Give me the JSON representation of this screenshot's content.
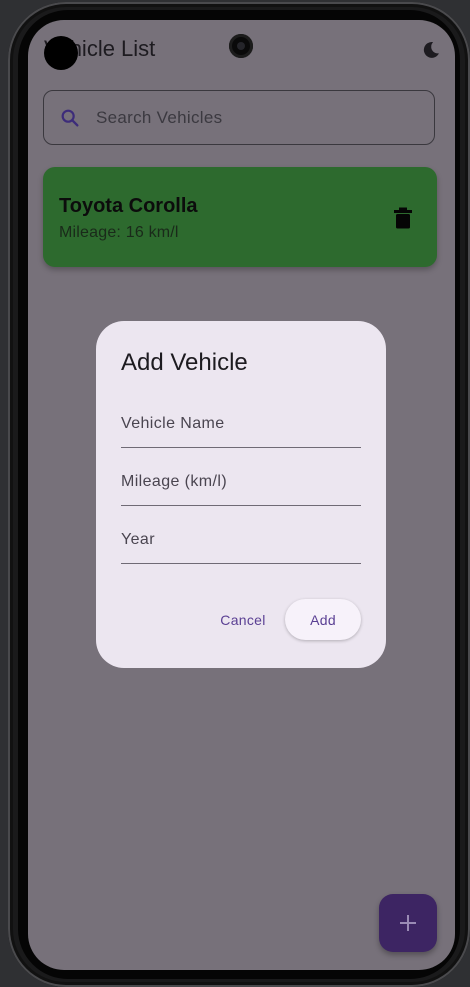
{
  "app_bar": {
    "title": "Vehicle List",
    "theme_icon": "moon-icon"
  },
  "search": {
    "placeholder": "Search Vehicles",
    "icon": "search-icon"
  },
  "vehicles": [
    {
      "name": "Toyota Corolla",
      "subtitle": "Mileage: 16 km/l",
      "card_color": "#2d6a2e",
      "action_icon": "trash-icon"
    }
  ],
  "dialog": {
    "title": "Add Vehicle",
    "fields": [
      {
        "label": "Vehicle Name"
      },
      {
        "label": "Mileage (km/l)"
      },
      {
        "label": "Year"
      }
    ],
    "cancel_label": "Cancel",
    "add_label": "Add"
  },
  "fab": {
    "icon": "plus-icon",
    "color": "#3d2563"
  },
  "colors": {
    "accent": "#5a3f93",
    "dialog_bg": "#ece6f0",
    "scrim": "#77717a"
  }
}
